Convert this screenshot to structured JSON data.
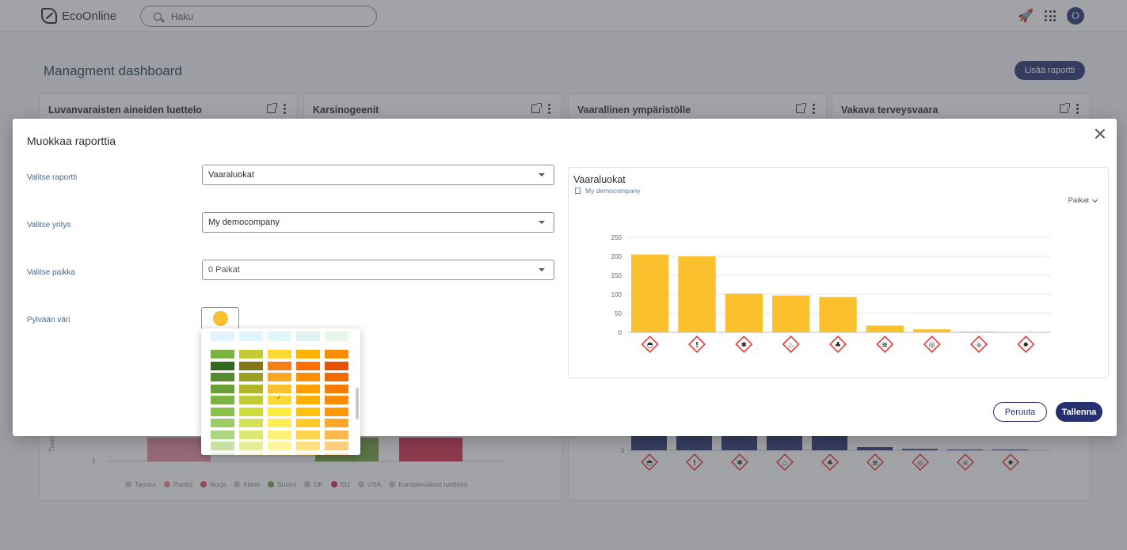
{
  "app": {
    "logo_text": "EcoOnline",
    "search_placeholder": "Haku",
    "avatar_initial": "O",
    "icons": [
      "rocket-icon",
      "apps-grid-icon"
    ]
  },
  "dashboard": {
    "title": "Managment dashboard",
    "add_report_label": "Lisää raportti",
    "cards": [
      {
        "title": "Luvanvaraisten aineiden luettelo"
      },
      {
        "title": "Karsinogeenit"
      },
      {
        "title": "Vaarallinen ympäristölle"
      },
      {
        "title": "Vakava terveysvaara"
      }
    ],
    "legend": [
      {
        "label": "Tanska",
        "color": "#c7c7c7"
      },
      {
        "label": "Ruotsi",
        "color": "#e58a9b"
      },
      {
        "label": "Norja",
        "color": "#d94b66"
      },
      {
        "label": "Irlanti",
        "color": "#c7c7c7"
      },
      {
        "label": "Suomi",
        "color": "#6fa03c"
      },
      {
        "label": "UK",
        "color": "#c7c7c7"
      },
      {
        "label": "EU",
        "color": "#d42a4c"
      },
      {
        "label": "USA",
        "color": "#c7c7c7"
      },
      {
        "label": "Kansainväliset luettelot",
        "color": "#c7c7c7"
      }
    ],
    "bg_bar_color": "#26306e"
  },
  "modal": {
    "title": "Muokkaa raporttia",
    "fields": {
      "report_label": "Valitse raportti",
      "report_value": "Vaaraluokat",
      "company_label": "Valitse yritys",
      "company_value": "My democompany",
      "location_label": "Valitse paikka",
      "location_value": "0 Paikat",
      "color_label": "Pylvään väri",
      "color_value": "#fbc02d"
    },
    "preview": {
      "title": "Vaaraluokat",
      "company": "My democompany",
      "filter_label": "Paikat"
    },
    "cancel_label": "Peruuta",
    "save_label": "Tallenna",
    "palette": {
      "selected": "#fdd835",
      "columns": [
        [
          "#7cb342",
          "#33691e",
          "#558b2f",
          "#689f38",
          "#7cb342",
          "#8bc34a",
          "#9ccc65",
          "#aed581",
          "#c5e1a5",
          "#dcedc8"
        ],
        [
          "#c0ca33",
          "#827717",
          "#9e9d24",
          "#afb42b",
          "#c0ca33",
          "#cddc39",
          "#d4e157",
          "#dce775",
          "#e6ee9c",
          "#f0f4c3"
        ],
        [
          "#fdd835",
          "#f57f17",
          "#f9a825",
          "#fbc02d",
          "#fdd835",
          "#ffeb3b",
          "#ffee58",
          "#fff176",
          "#fff59d",
          "#fff9c4"
        ],
        [
          "#ffb300",
          "#ff6f00",
          "#ff8f00",
          "#ffa000",
          "#ffb300",
          "#ffc107",
          "#ffca28",
          "#ffd54f",
          "#ffe082",
          "#ffecb3"
        ],
        [
          "#fb8c00",
          "#e65100",
          "#ef6c00",
          "#f57c00",
          "#fb8c00",
          "#ff9800",
          "#ffa726",
          "#ffb74d",
          "#ffcc80",
          "#ffe0b2"
        ]
      ],
      "top_row": [
        "#e3f2fd",
        "#e1f5fe",
        "#e0f7fa",
        "#e0f2f1",
        "#e8f5e9"
      ]
    }
  },
  "chart_data": {
    "type": "bar",
    "categories": [
      "GHS04",
      "GHS07",
      "GHS08",
      "GHS02",
      "GHS09",
      "GHS05",
      "GHS03",
      "GHS06",
      "GHS01"
    ],
    "category_icons": [
      "gas-cylinder-icon",
      "exclamation-icon",
      "health-hazard-icon",
      "flame-icon",
      "environment-icon",
      "corrosion-icon",
      "oxidizer-icon",
      "skull-icon",
      "explosive-icon"
    ],
    "values": [
      205,
      200,
      102,
      97,
      93,
      18,
      8,
      2,
      1
    ],
    "ylim": [
      0,
      250
    ],
    "yticks": [
      0,
      50,
      100,
      150,
      200,
      250
    ],
    "grid": true,
    "bar_color": "#fbc02d"
  }
}
